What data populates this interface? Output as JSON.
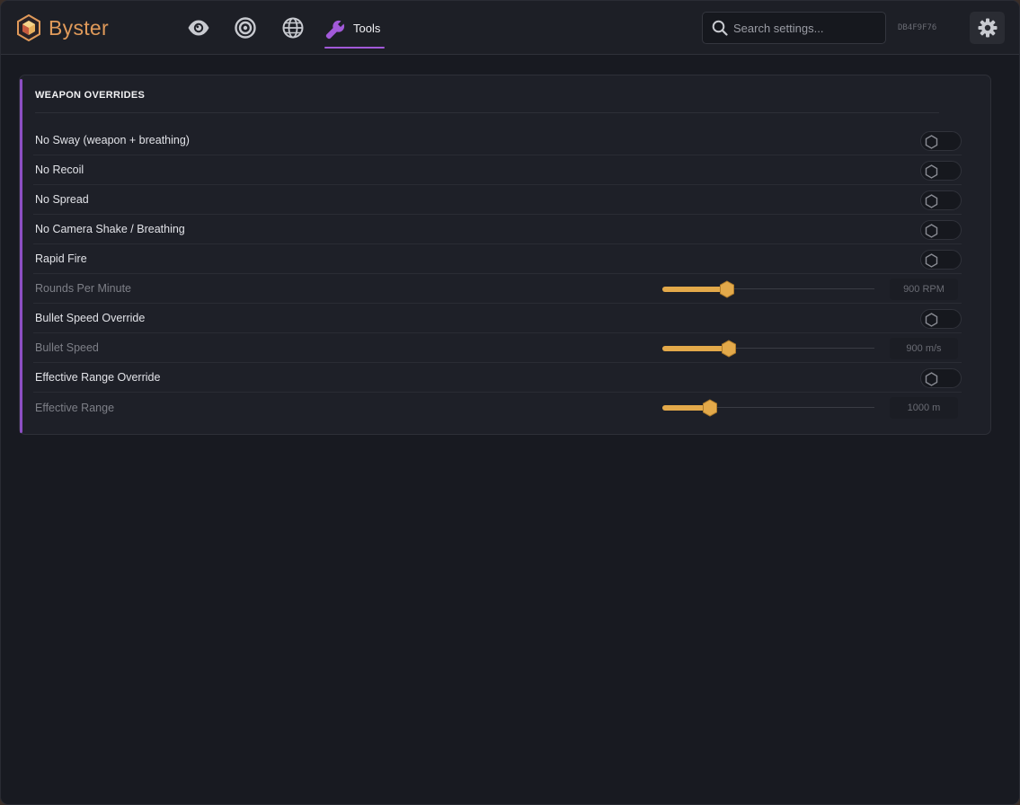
{
  "app": {
    "name": "Byster",
    "hwid": "DB4F9F76"
  },
  "nav": {
    "tabs": [
      {
        "icon": "eye-icon",
        "label": ""
      },
      {
        "icon": "target-icon",
        "label": ""
      },
      {
        "icon": "globe-icon",
        "label": ""
      },
      {
        "icon": "wrench-icon",
        "label": "Tools",
        "active": true
      }
    ]
  },
  "search": {
    "placeholder": "Search settings...",
    "value": ""
  },
  "colors": {
    "accent": "#a259d9",
    "slider": "#e3a94a",
    "brand": "#e09a5a"
  },
  "panel": {
    "title": "WEAPON OVERRIDES",
    "rows": [
      {
        "label": "No Sway (weapon + breathing)",
        "type": "toggle",
        "on": false
      },
      {
        "label": "No Recoil",
        "type": "toggle",
        "on": false
      },
      {
        "label": "No Spread",
        "type": "toggle",
        "on": false
      },
      {
        "label": "No Camera Shake / Breathing",
        "type": "toggle",
        "on": false
      },
      {
        "label": "Rapid Fire",
        "type": "toggle",
        "on": false
      },
      {
        "label": "Rounds Per Minute",
        "type": "slider",
        "fraction": 0.305,
        "value": "900 RPM",
        "disabled": true
      },
      {
        "label": "Bullet Speed Override",
        "type": "toggle",
        "on": false
      },
      {
        "label": "Bullet Speed",
        "type": "slider",
        "fraction": 0.315,
        "value": "900 m/s",
        "disabled": true
      },
      {
        "label": "Effective Range Override",
        "type": "toggle",
        "on": false
      },
      {
        "label": "Effective Range",
        "type": "slider",
        "fraction": 0.225,
        "value": "1000 m",
        "disabled": true
      }
    ]
  }
}
